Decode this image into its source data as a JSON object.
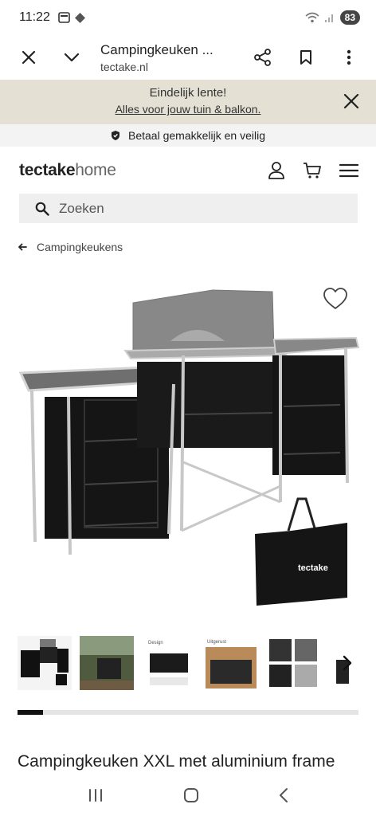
{
  "status_bar": {
    "time": "11:22",
    "battery": "83"
  },
  "browser": {
    "page_title": "Campingkeuken ...",
    "domain": "tectake.nl"
  },
  "promo": {
    "title": "Eindelijk lente!",
    "link": "Alles voor jouw tuin & balkon."
  },
  "secure_banner": {
    "text": "Betaal gemakkelijk en veilig"
  },
  "site": {
    "logo_bold": "tectake",
    "logo_light": "home"
  },
  "search": {
    "placeholder": "Zoeken"
  },
  "breadcrumb": {
    "label": "Campingkeukens"
  },
  "product": {
    "image_brand": "tectake",
    "title": "Campingkeuken XXL met aluminium frame",
    "gallery_progress": 0.075
  },
  "thumbnails": [
    {
      "label": ""
    },
    {
      "label": ""
    },
    {
      "label": "Design"
    },
    {
      "label": "Uitgerust"
    },
    {
      "label": ""
    },
    {
      "label": ""
    }
  ],
  "colors": {
    "promo_bg": "#e4e0d4",
    "accent": "#111111",
    "search_bg": "#efefef"
  }
}
